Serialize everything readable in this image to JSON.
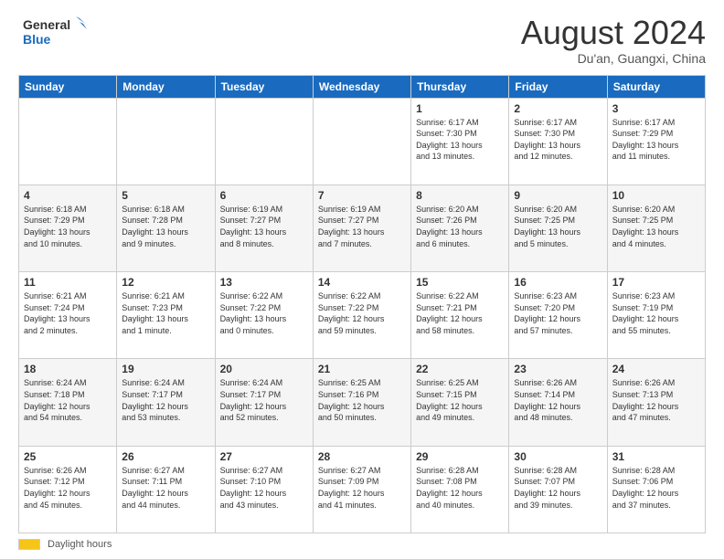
{
  "header": {
    "logo_line1": "General",
    "logo_line2": "Blue",
    "month": "August 2024",
    "location": "Du'an, Guangxi, China"
  },
  "days_of_week": [
    "Sunday",
    "Monday",
    "Tuesday",
    "Wednesday",
    "Thursday",
    "Friday",
    "Saturday"
  ],
  "footer": {
    "daylight_label": "Daylight hours"
  },
  "weeks": [
    [
      {
        "day": "",
        "info": ""
      },
      {
        "day": "",
        "info": ""
      },
      {
        "day": "",
        "info": ""
      },
      {
        "day": "",
        "info": ""
      },
      {
        "day": "1",
        "info": "Sunrise: 6:17 AM\nSunset: 7:30 PM\nDaylight: 13 hours\nand 13 minutes."
      },
      {
        "day": "2",
        "info": "Sunrise: 6:17 AM\nSunset: 7:30 PM\nDaylight: 13 hours\nand 12 minutes."
      },
      {
        "day": "3",
        "info": "Sunrise: 6:17 AM\nSunset: 7:29 PM\nDaylight: 13 hours\nand 11 minutes."
      }
    ],
    [
      {
        "day": "4",
        "info": "Sunrise: 6:18 AM\nSunset: 7:29 PM\nDaylight: 13 hours\nand 10 minutes."
      },
      {
        "day": "5",
        "info": "Sunrise: 6:18 AM\nSunset: 7:28 PM\nDaylight: 13 hours\nand 9 minutes."
      },
      {
        "day": "6",
        "info": "Sunrise: 6:19 AM\nSunset: 7:27 PM\nDaylight: 13 hours\nand 8 minutes."
      },
      {
        "day": "7",
        "info": "Sunrise: 6:19 AM\nSunset: 7:27 PM\nDaylight: 13 hours\nand 7 minutes."
      },
      {
        "day": "8",
        "info": "Sunrise: 6:20 AM\nSunset: 7:26 PM\nDaylight: 13 hours\nand 6 minutes."
      },
      {
        "day": "9",
        "info": "Sunrise: 6:20 AM\nSunset: 7:25 PM\nDaylight: 13 hours\nand 5 minutes."
      },
      {
        "day": "10",
        "info": "Sunrise: 6:20 AM\nSunset: 7:25 PM\nDaylight: 13 hours\nand 4 minutes."
      }
    ],
    [
      {
        "day": "11",
        "info": "Sunrise: 6:21 AM\nSunset: 7:24 PM\nDaylight: 13 hours\nand 2 minutes."
      },
      {
        "day": "12",
        "info": "Sunrise: 6:21 AM\nSunset: 7:23 PM\nDaylight: 13 hours\nand 1 minute."
      },
      {
        "day": "13",
        "info": "Sunrise: 6:22 AM\nSunset: 7:22 PM\nDaylight: 13 hours\nand 0 minutes."
      },
      {
        "day": "14",
        "info": "Sunrise: 6:22 AM\nSunset: 7:22 PM\nDaylight: 12 hours\nand 59 minutes."
      },
      {
        "day": "15",
        "info": "Sunrise: 6:22 AM\nSunset: 7:21 PM\nDaylight: 12 hours\nand 58 minutes."
      },
      {
        "day": "16",
        "info": "Sunrise: 6:23 AM\nSunset: 7:20 PM\nDaylight: 12 hours\nand 57 minutes."
      },
      {
        "day": "17",
        "info": "Sunrise: 6:23 AM\nSunset: 7:19 PM\nDaylight: 12 hours\nand 55 minutes."
      }
    ],
    [
      {
        "day": "18",
        "info": "Sunrise: 6:24 AM\nSunset: 7:18 PM\nDaylight: 12 hours\nand 54 minutes."
      },
      {
        "day": "19",
        "info": "Sunrise: 6:24 AM\nSunset: 7:17 PM\nDaylight: 12 hours\nand 53 minutes."
      },
      {
        "day": "20",
        "info": "Sunrise: 6:24 AM\nSunset: 7:17 PM\nDaylight: 12 hours\nand 52 minutes."
      },
      {
        "day": "21",
        "info": "Sunrise: 6:25 AM\nSunset: 7:16 PM\nDaylight: 12 hours\nand 50 minutes."
      },
      {
        "day": "22",
        "info": "Sunrise: 6:25 AM\nSunset: 7:15 PM\nDaylight: 12 hours\nand 49 minutes."
      },
      {
        "day": "23",
        "info": "Sunrise: 6:26 AM\nSunset: 7:14 PM\nDaylight: 12 hours\nand 48 minutes."
      },
      {
        "day": "24",
        "info": "Sunrise: 6:26 AM\nSunset: 7:13 PM\nDaylight: 12 hours\nand 47 minutes."
      }
    ],
    [
      {
        "day": "25",
        "info": "Sunrise: 6:26 AM\nSunset: 7:12 PM\nDaylight: 12 hours\nand 45 minutes."
      },
      {
        "day": "26",
        "info": "Sunrise: 6:27 AM\nSunset: 7:11 PM\nDaylight: 12 hours\nand 44 minutes."
      },
      {
        "day": "27",
        "info": "Sunrise: 6:27 AM\nSunset: 7:10 PM\nDaylight: 12 hours\nand 43 minutes."
      },
      {
        "day": "28",
        "info": "Sunrise: 6:27 AM\nSunset: 7:09 PM\nDaylight: 12 hours\nand 41 minutes."
      },
      {
        "day": "29",
        "info": "Sunrise: 6:28 AM\nSunset: 7:08 PM\nDaylight: 12 hours\nand 40 minutes."
      },
      {
        "day": "30",
        "info": "Sunrise: 6:28 AM\nSunset: 7:07 PM\nDaylight: 12 hours\nand 39 minutes."
      },
      {
        "day": "31",
        "info": "Sunrise: 6:28 AM\nSunset: 7:06 PM\nDaylight: 12 hours\nand 37 minutes."
      }
    ]
  ]
}
